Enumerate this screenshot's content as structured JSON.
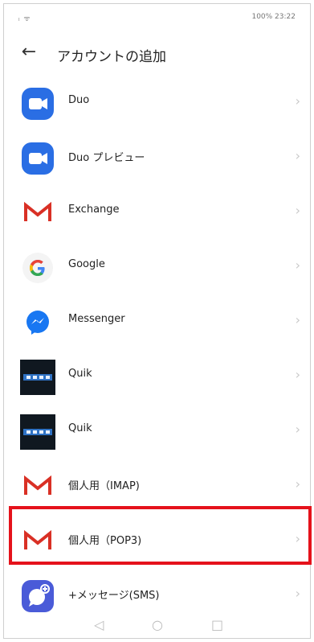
{
  "status": {
    "left": "ₗ ᯤ",
    "right": "100% 23:22"
  },
  "header": {
    "back_icon": "arrow-left-icon",
    "title": "アカウントの追加"
  },
  "accounts": [
    {
      "label": "Duo",
      "icon": "duo-icon",
      "color": "#2a6ee4"
    },
    {
      "label": "Duo プレビュー",
      "icon": "duo-preview-icon",
      "color": "#2a6ee4"
    },
    {
      "label": "Exchange",
      "icon": "gmail-icon",
      "color": "#d93025"
    },
    {
      "label": "Google",
      "icon": "google-g-icon",
      "color": "#4285f4"
    },
    {
      "label": "Messenger",
      "icon": "messenger-icon",
      "color": "#1877f2"
    },
    {
      "label": "Quik",
      "icon": "quik-icon",
      "color": "#101820"
    },
    {
      "label": "Quik",
      "icon": "quik-icon",
      "color": "#101820"
    },
    {
      "label": "個人用（IMAP)",
      "icon": "gmail-icon",
      "color": "#d93025"
    },
    {
      "label": "個人用（POP3)",
      "icon": "gmail-icon",
      "color": "#d93025"
    },
    {
      "label": "+メッセージ(SMS)",
      "icon": "plus-message-icon",
      "color": "#4a5bd8"
    }
  ],
  "highlight_color": "#e5121b",
  "navbar": {
    "back": "◁",
    "home": "○",
    "recent": "□"
  }
}
